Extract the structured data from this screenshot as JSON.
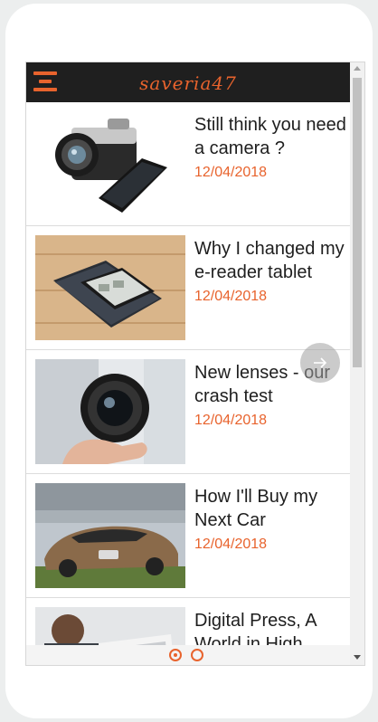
{
  "header": {
    "brand": "saveria47",
    "menu_icon": "hamburger-menu-icon",
    "accent_color": "#e8632d",
    "background_color": "#1f1f1f"
  },
  "articles": [
    {
      "title": "Still think you need a camera ?",
      "date": "12/04/2018",
      "image": "camera-and-phone"
    },
    {
      "title": "Why I changed my e-reader tablet",
      "date": "12/04/2018",
      "image": "e-reader-on-wood"
    },
    {
      "title": "New lenses - our crash test",
      "date": "12/04/2018",
      "image": "hand-holding-lens"
    },
    {
      "title": "How I'll Buy my Next Car",
      "date": "12/04/2018",
      "image": "concept-car"
    },
    {
      "title": "Digital Press, A World in High",
      "date": "",
      "image": "person-with-tablet"
    }
  ],
  "controls": {
    "next_icon": "arrow-right-icon",
    "pager": {
      "pages": 2,
      "current": 1
    }
  }
}
